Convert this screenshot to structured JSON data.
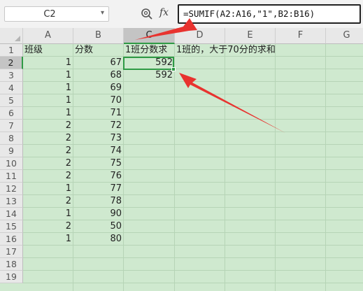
{
  "name_box": {
    "value": "C2"
  },
  "formula_bar": {
    "fx_label": "fx",
    "formula": "=SUMIF(A2:A16,\"1\",B2:B16)"
  },
  "columns": [
    "A",
    "B",
    "C",
    "D",
    "E",
    "F",
    "G"
  ],
  "rows": [
    "1",
    "2",
    "3",
    "4",
    "5",
    "6",
    "7",
    "8",
    "9",
    "10",
    "11",
    "12",
    "13",
    "14",
    "15",
    "16",
    "17",
    "18",
    "19"
  ],
  "cells": {
    "A1": "班级",
    "B1": "分数",
    "C1": "1班分数求",
    "D1": "1班的，大于70分的求和",
    "A2": "1",
    "B2": "67",
    "C2": "592",
    "A3": "1",
    "B3": "68",
    "C3": "592",
    "A4": "1",
    "B4": "69",
    "A5": "1",
    "B5": "70",
    "A6": "1",
    "B6": "71",
    "A7": "2",
    "B7": "72",
    "A8": "2",
    "B8": "73",
    "A9": "2",
    "B9": "74",
    "A10": "2",
    "B10": "75",
    "A11": "2",
    "B11": "76",
    "A12": "1",
    "B12": "77",
    "A13": "2",
    "B13": "78",
    "A14": "1",
    "B14": "90",
    "A15": "2",
    "B15": "50",
    "A16": "1",
    "B16": "80"
  },
  "colors": {
    "selection": "#2f9a45",
    "sheet_bg": "#cfe9cf",
    "arrow": "#e8332f"
  },
  "icons": {
    "zoom": "zoom-icon",
    "dropdown": "chevron-down-icon",
    "function": "fx-icon"
  }
}
